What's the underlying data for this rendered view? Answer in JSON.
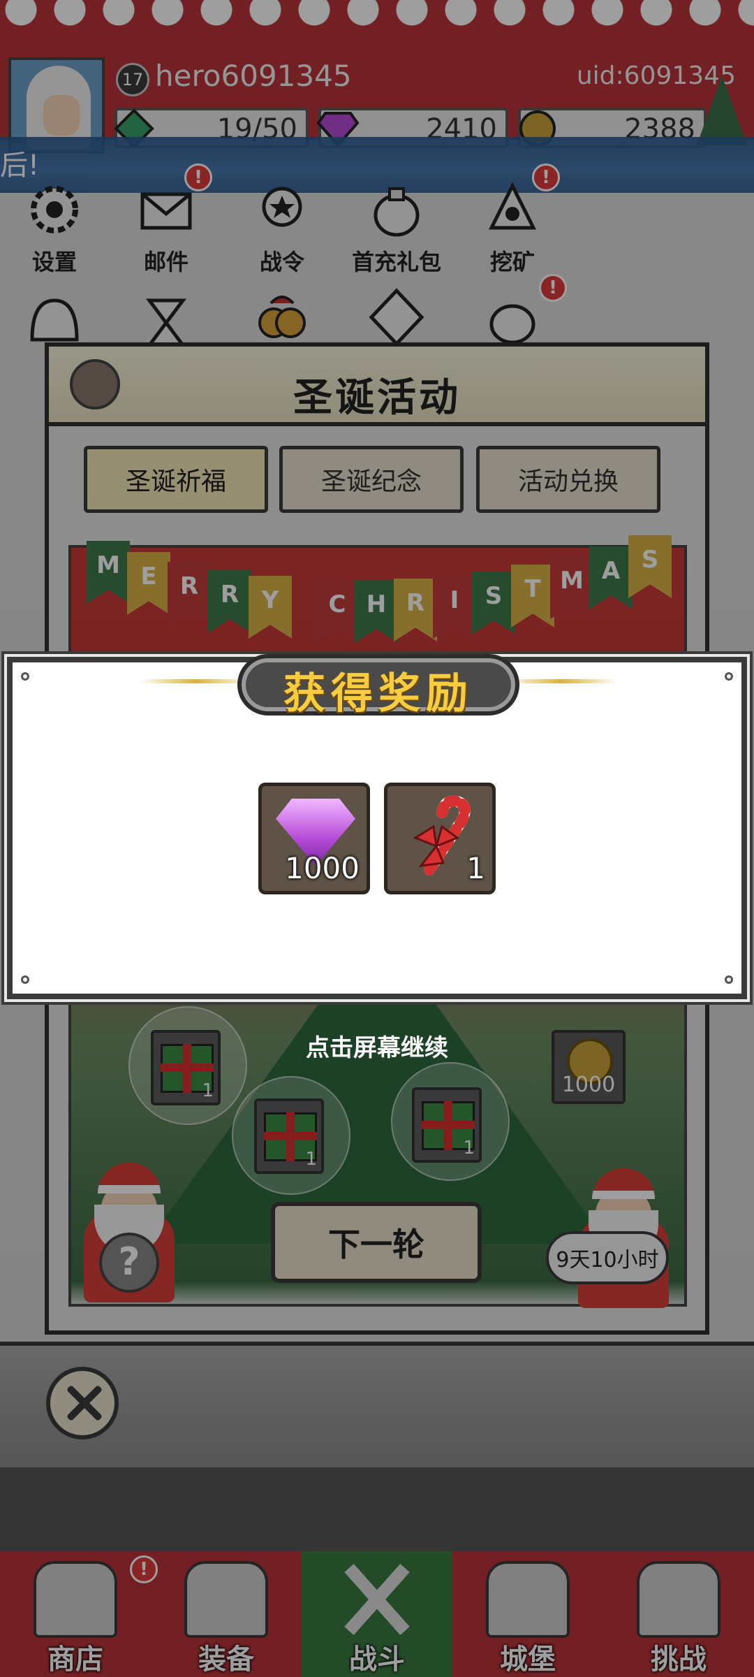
{
  "player": {
    "level": "17",
    "name": "hero6091345",
    "uid": "uid:6091345"
  },
  "resources": [
    {
      "name": "stamina",
      "value": "19/50",
      "color": "#3aa06a"
    },
    {
      "name": "gems",
      "value": "2410",
      "color": "#b54ad6"
    },
    {
      "name": "coins",
      "value": "2388",
      "color": "#c9a43a"
    }
  ],
  "notice": {
    "text": "后!"
  },
  "menu_row1": [
    {
      "label": "设置",
      "icon": "gear-icon"
    },
    {
      "label": "邮件",
      "icon": "mail-icon",
      "badge": "!"
    },
    {
      "label": "战令",
      "icon": "battle-pass-icon"
    },
    {
      "label": "首充礼包",
      "icon": "first-recharge-icon"
    },
    {
      "label": "挖矿",
      "icon": "mining-icon",
      "badge": "!"
    }
  ],
  "menu_row2": [
    {
      "label": "",
      "icon": "helmet-icon"
    },
    {
      "label": "",
      "icon": "hourglass-icon"
    },
    {
      "label": "",
      "icon": "christmas-bell-icon"
    },
    {
      "label": "",
      "icon": "ranking-icon"
    },
    {
      "label": "",
      "icon": "bag-icon",
      "badge": "!"
    }
  ],
  "event": {
    "title": "圣诞活动",
    "tabs": [
      "圣诞祈福",
      "圣诞纪念",
      "活动兑换"
    ],
    "banner_letters": [
      "M",
      "E",
      "R",
      "R",
      "Y",
      "C",
      "H",
      "R",
      "I",
      "S",
      "T",
      "M",
      "A",
      "S"
    ],
    "gift_qty": "1",
    "coin_qty": "1000",
    "next_button": "下一轮",
    "timer": "9天10小时",
    "mystery": "?"
  },
  "reward_modal": {
    "title": "获得奖励",
    "items": [
      {
        "name": "gem",
        "qty": "1000",
        "icon": "purple-gem-icon"
      },
      {
        "name": "candy-cane",
        "qty": "1",
        "icon": "candy-cane-icon"
      }
    ],
    "continue_hint": "点击屏幕继续"
  },
  "bottom_nav": [
    {
      "label": "商店",
      "icon": "shop-icon",
      "badge": "!"
    },
    {
      "label": "装备",
      "icon": "equipment-icon"
    },
    {
      "label": "战斗",
      "icon": "crossed-swords-icon",
      "active": true
    },
    {
      "label": "城堡",
      "icon": "castle-icon"
    },
    {
      "label": "挑战",
      "icon": "challenge-icon"
    }
  ]
}
